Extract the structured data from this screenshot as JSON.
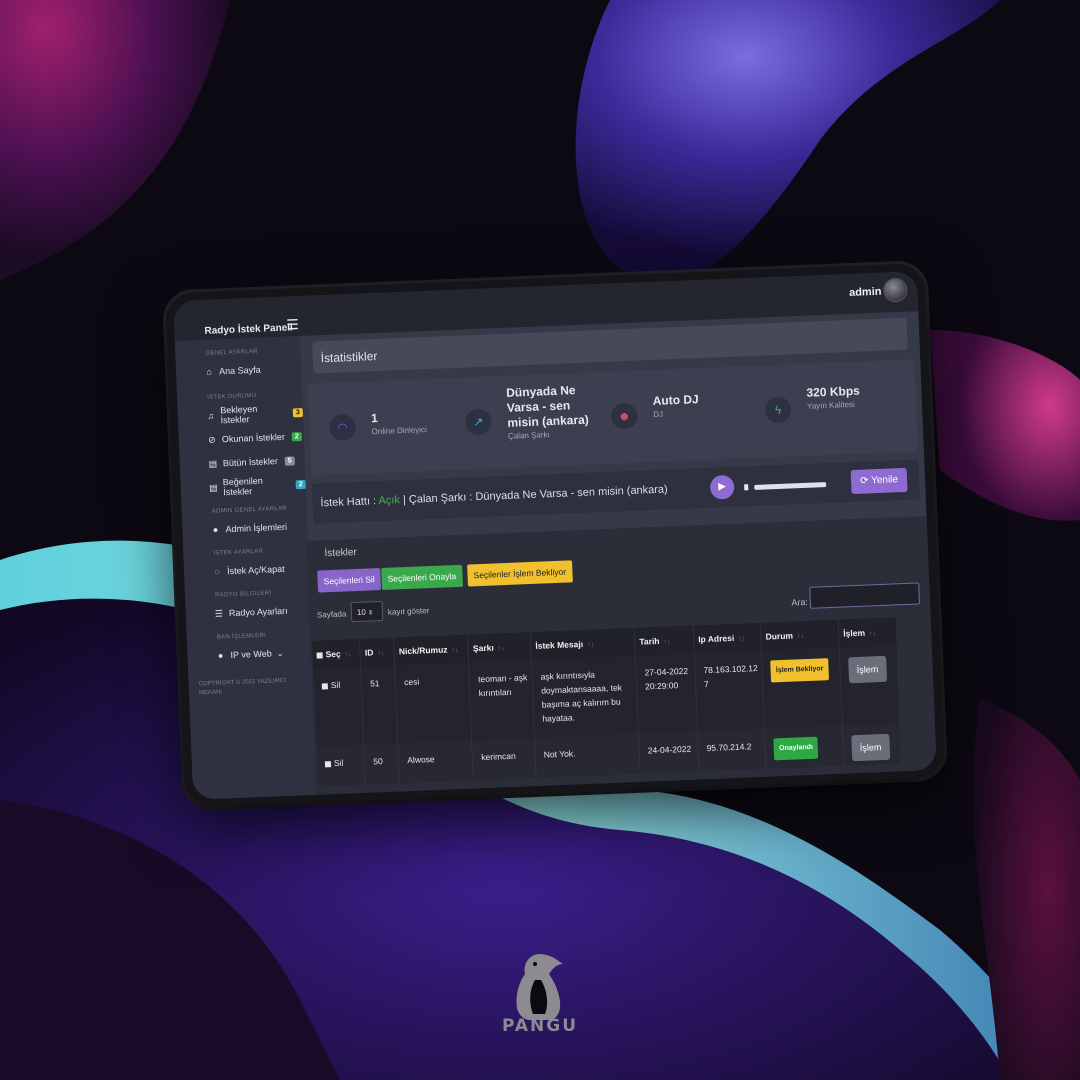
{
  "colors": {
    "accent": "#8d6bd0",
    "success": "#3aa94b",
    "warning": "#f0c02e",
    "background": "#0d0913"
  },
  "app": {
    "brand": "Radyo İstek Paneli",
    "menu_icon": "hamburger-icon"
  },
  "user": {
    "name": "admin"
  },
  "sidebar": {
    "sections": [
      {
        "title": "GENEL AYARLAR",
        "items": [
          {
            "label": "Ana Sayfa",
            "icon": "home-icon"
          }
        ]
      },
      {
        "title": "İSTEK DURUMU",
        "items": [
          {
            "label": "Bekleyen İstekler",
            "icon": "music-icon",
            "badge": "3",
            "badge_color": "#f0c02e"
          },
          {
            "label": "Okunan İstekler",
            "icon": "check-circle-icon",
            "badge": "2",
            "badge_color": "#3aa94b"
          },
          {
            "label": "Bütün İstekler",
            "icon": "file-icon",
            "badge": "5",
            "badge_color": "#8a8c98"
          },
          {
            "label": "Beğenilen İstekler",
            "icon": "file-icon",
            "badge": "2",
            "badge_color": "#35a8c0"
          }
        ]
      },
      {
        "title": "ADMIN GENEL AYARLAR",
        "items": [
          {
            "label": "Admin İşlemleri",
            "icon": "user-icon"
          }
        ]
      },
      {
        "title": "İSTEK AYARLAR",
        "items": [
          {
            "label": "İstek Aç/Kapat",
            "icon": "chat-icon"
          }
        ]
      },
      {
        "title": "RADYO BİLGİLERİ",
        "items": [
          {
            "label": "Radyo Ayarları",
            "icon": "sliders-icon"
          }
        ]
      },
      {
        "title": "BAN İŞLEMLERİ",
        "items": [
          {
            "label": "IP ve Web",
            "icon": "user-icon"
          }
        ]
      }
    ],
    "copyright": "COPYRIGHT © 2022 YAZILIMCI MEKANI"
  },
  "stats": {
    "title": "İstatistikler",
    "items": [
      {
        "value": "1",
        "label": "Online Dinleyici",
        "icon": "headphones-icon",
        "color": "#6f66e0"
      },
      {
        "value": "Dünyada Ne Varsa - sen misin (ankara)",
        "label": "Çalan Şarkı",
        "icon": "trend-icon",
        "color": "#3fa7e0"
      },
      {
        "value": "Auto DJ",
        "label": "DJ",
        "icon": "users-icon",
        "color": "#e0506a"
      },
      {
        "value": "320 Kbps",
        "label": "Yayın Kalitesi",
        "icon": "bolt-icon",
        "color": "#3fb94d"
      }
    ]
  },
  "player": {
    "line_label": "İstek Hattı : ",
    "line_status": "Açık",
    "song_label": " | Çalan Şarkı : Dünyada Ne Varsa - sen misin (ankara)",
    "refresh": "Yenile"
  },
  "requests": {
    "title": "İstekler",
    "buttons": {
      "delete": "Seçilenleri Sil",
      "approve": "Seçilenleri Onayla",
      "pending": "Seçilenler İşlem Bekliyor"
    },
    "page_prefix": "Sayfada",
    "page_size": "10",
    "page_suffix": "kayıt göster",
    "search_label": "Ara:",
    "columns": [
      "Seç",
      "ID",
      "Nick/Rumuz",
      "Şarkı",
      "İstek Mesajı",
      "Tarih",
      "Ip Adresi",
      "Durum",
      "İşlem"
    ],
    "rows": [
      {
        "select": "Sil",
        "id": "51",
        "nick": "cesi",
        "song": "teoman - aşk kırıntıları",
        "message": "aşk kırıntısıyla doymaktansaaaa, tek başıma aç kalırım bu hayataa.",
        "date": "27-04-2022 20:29:00",
        "ip": "78.163.102.127",
        "status": "İşlem Bekliyor",
        "status_type": "warning",
        "action": "İşlem"
      },
      {
        "select": "Sil",
        "id": "50",
        "nick": "Alwose",
        "song": "kerimcan",
        "message": "Not Yok.",
        "date": "24-04-2022",
        "ip": "95.70.214.2",
        "status": "Onaylandı",
        "status_type": "success",
        "action": "İşlem"
      }
    ]
  },
  "logo": {
    "text": "PANGU",
    "icon": "penguin-icon"
  }
}
